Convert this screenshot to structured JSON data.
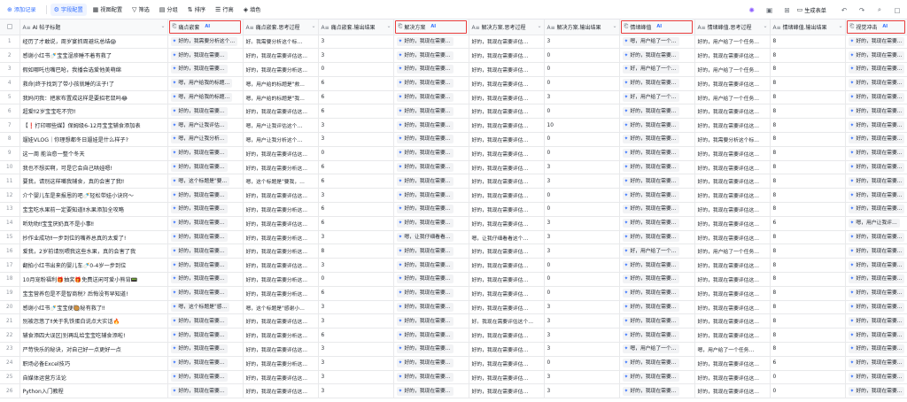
{
  "toolbar": {
    "add_record": "添加记录",
    "field_config": "字段配置",
    "view_config": "视图配置",
    "filter": "筛选",
    "group": "分组",
    "sort": "排序",
    "row_height": "行高",
    "fill_color": "填色",
    "generate_form": "生成表单",
    "accent_color": "#3370ff",
    "highlight_color": "#e83b3b"
  },
  "columns": [
    {
      "label": "AI 帖子标题",
      "icon": "text-icon",
      "ai": false
    },
    {
      "label": "痛点嵌套",
      "icon": "ai-field-icon",
      "ai": true,
      "highlight": true
    },
    {
      "label": "痛点嵌套.思考过程",
      "icon": "text-icon",
      "ai": false
    },
    {
      "label": "痛点嵌套.输出结果",
      "icon": "text-icon",
      "ai": false
    },
    {
      "label": "解决方案",
      "icon": "ai-field-icon",
      "ai": true,
      "highlight": true
    },
    {
      "label": "解决方案.思考过程",
      "icon": "text-icon",
      "ai": false
    },
    {
      "label": "解决方案.输出结果",
      "icon": "text-icon",
      "ai": false
    },
    {
      "label": "情绪峰值",
      "icon": "ai-field-icon",
      "ai": true,
      "highlight": true
    },
    {
      "label": "情绪峰值.思考过程",
      "icon": "text-icon",
      "ai": false
    },
    {
      "label": "情绪峰值.输出结果",
      "icon": "text-icon",
      "ai": false
    },
    {
      "label": "视觉冲击",
      "icon": "ai-field-icon",
      "ai": true,
      "highlight": true
    }
  ],
  "rows": [
    {
      "n": "1",
      "title": "经历了才敢说，周岁宴抓周避坑总结😱",
      "c1": "好的，我需要分析这个…",
      "c2": "好。我需要分析这个标…",
      "c3": "3",
      "c4": "好的，我现在需要…",
      "c5": "好的，我现在需要评估…",
      "c6": "3",
      "c7": "嗯，用户给了一个…",
      "c8": "好的，用户给了一个任务…",
      "c9": "8",
      "c10": "好的，我现在需要…"
    },
    {
      "n": "2",
      "title": "感谢小红书🍼宝宝湿疹睡不着有救了",
      "c1": "好的，我现在需要…",
      "c2": "好的，我现在需要评估这…",
      "c3": "3",
      "c4": "好的，我现在需要…",
      "c5": "好的，我现在需要评估…",
      "c6": "0",
      "c7": "好的，我现在需要…",
      "c8": "好的，我现在需要评估这…",
      "c9": "8",
      "c10": "好的，我现在需要…"
    },
    {
      "n": "3",
      "title": "假如哪吒也嘴巴呛，我播会选爱他美萌绵",
      "c1": "好的，我现在需要…",
      "c2": "好的，我现在需要分析这…",
      "c3": "0",
      "c4": "好的，我现在需要…",
      "c5": "好的，我现在需要评估…",
      "c6": "0",
      "c7": "好，用户给了一个…",
      "c8": "好的，用户给了一个任务…",
      "c9": "8",
      "c10": "好的，我现在需要…"
    },
    {
      "n": "4",
      "title": "救命|终于找到了带小孩就睡的法子!了",
      "c1": "嗯，用户给我的标题…",
      "c2": "嗯，用户给的标题是\"救…",
      "c3": "6",
      "c4": "好的，我现在需要…",
      "c5": "好的，我现在需要评估…",
      "c6": "0",
      "c7": "好的，我现在需要…",
      "c8": "好的，我现在需要评估这…",
      "c9": "8",
      "c10": "好的，我现在需要…"
    },
    {
      "n": "5",
      "title": "我妈问我：把家布置成这样是要招老鼠吗😂",
      "c1": "嗯，用户给我的标题…",
      "c2": "嗯，用户给的标题是\"我…",
      "c3": "6",
      "c4": "好的，我现在需要…",
      "c5": "好的，我现在需要评估…",
      "c6": "3",
      "c7": "好，用户给了一个…",
      "c8": "好的，用户给了一个任务…",
      "c9": "8",
      "c10": "好的，我现在需要…"
    },
    {
      "n": "6",
      "title": "超爱‼2岁宝宝吃不完‼",
      "c1": "好的，我现在需要…",
      "c2": "好的，我现在需要评估这…",
      "c3": "6",
      "c4": "好的，我现在需要…",
      "c5": "好的，我现在需要评估…",
      "c6": "0",
      "c7": "好的，我现在需要…",
      "c8": "好的，我现在需要评估这…",
      "c9": "8",
      "c10": "好的，我现在需要…"
    },
    {
      "n": "7",
      "title": "【❗打印哪些媒】保姆级6-12月宝宝辅食添加表",
      "c1": "嗯，用户让我评估…",
      "c2": "嗯，用户让我评估这个…",
      "c3": "3",
      "c4": "好的，我现在需要…",
      "c5": "好的，我现在需要评估…",
      "c6": "10",
      "c7": "好的，我现在需要…",
      "c8": "好的，我现在需要评估这…",
      "c9": "8",
      "c10": "好的，我现在需要…"
    },
    {
      "n": "8",
      "title": "遛娃VLOG｜你理想都冬日遛娃是什么样子?",
      "c1": "嗯，用户让我分析…",
      "c2": "嗯，用户让我分析这个…",
      "c3": "3",
      "c4": "好的，我现在需要…",
      "c5": "好的，我现在需要评估…",
      "c6": "0",
      "c7": "好的，我现在需要…",
      "c8": "好的，我需要分析这个标…",
      "c9": "8",
      "c10": "好的，我现在需要…"
    },
    {
      "n": "9",
      "title": "这一周 能治愈一整个冬天",
      "c1": "好的，我现在需要…",
      "c2": "好的，我现在需要评估这…",
      "c3": "0",
      "c4": "好的，我现在需要…",
      "c5": "好的，我现在需要评估…",
      "c6": "0",
      "c7": "好的，我现在需要…",
      "c8": "好的，我现在需要评估这…",
      "c9": "8",
      "c10": "好的，我现在需要…"
    },
    {
      "n": "10",
      "title": "我也不想买啊，可是它会自己哄娃嗯!",
      "c1": "好的，我现在需要…",
      "c2": "好的，我现在需要分析这…",
      "c3": "6",
      "c4": "好的，我现在需要…",
      "c5": "好的，我现在需要评估…",
      "c6": "3",
      "c7": "好的，我现在需要…",
      "c8": "好的，我现在需要评估这…",
      "c9": "8",
      "c10": "好的，我现在需要…"
    },
    {
      "n": "11",
      "title": "要我，请别这样嘴我辅食，真的会害了我‼",
      "c1": "嗯，这个标题是\"要…",
      "c2": "嗯，这个标题是\"要我，…",
      "c3": "6",
      "c4": "好的，我现在需要…",
      "c5": "好的，我现在需要评估…",
      "c6": "3",
      "c7": "好的，我现在需要…",
      "c8": "好的，我现在需要评估这…",
      "c9": "8",
      "c10": "好的，我现在需要…"
    },
    {
      "n": "12",
      "title": "介个婴儿车是来报恩的吧🍼轻松带娃小诀窍～",
      "c1": "好的，我现在需要…",
      "c2": "好的，我现在需要评估这…",
      "c3": "3",
      "c4": "好的，我现在需要…",
      "c5": "好的，我现在需要评估…",
      "c6": "0",
      "c7": "好的，我现在需要…",
      "c8": "好的，我现在需要评估这…",
      "c9": "8",
      "c10": "好的，我现在需要…"
    },
    {
      "n": "13",
      "title": "宝宝吃水果前一定要知道‼水果添加全攻略",
      "c1": "好的，我现在需要…",
      "c2": "好的，我现在需要分析这…",
      "c3": "6",
      "c4": "好的，我现在需要…",
      "c5": "好的，我现在需要评估…",
      "c6": "0",
      "c7": "好的，我现在需要…",
      "c8": "好的，我现在需要评估这…",
      "c9": "8",
      "c10": "好的，我现在需要…"
    },
    {
      "n": "14",
      "title": "听劝劝‼宝宝厌奶真不是小事‼",
      "c1": "好的，我现在需要…",
      "c2": "好的，我现在需要评估这…",
      "c3": "6",
      "c4": "好的，我现在需要…",
      "c5": "好的，我现在需要评估…",
      "c6": "3",
      "c7": "好的，我现在需要…",
      "c8": "好的，我现在需要评估这…",
      "c9": "6",
      "c10": "嗯，用户让我评…"
    },
    {
      "n": "15",
      "title": "抄作业成功‼一步到位的嘴养总真的太爱了!",
      "c1": "好的，我现在需要…",
      "c2": "好的，我现在需要分析这…",
      "c3": "3",
      "c4": "嗯，让我仔细看看…",
      "c5": "嗯，让我仔细看看这个…",
      "c6": "3",
      "c7": "好的，我现在需要…",
      "c8": "好的，我现在需要评估这…",
      "c9": "8",
      "c10": "好的，我现在需要…"
    },
    {
      "n": "16",
      "title": "爱我，2岁前请别喂我这些水果，真的会害了我",
      "c1": "好的，我现在需要…",
      "c2": "好的，我现在需要分析这…",
      "c3": "8",
      "c4": "好的，我现在需要…",
      "c5": "好的，我现在需要评估…",
      "c6": "3",
      "c7": "好，用户给了一个…",
      "c8": "好的，用户给了一个任务…",
      "c9": "8",
      "c10": "好的，我现在需要…"
    },
    {
      "n": "17",
      "title": "翻拍小红书出来的婴儿车🍼0-4岁一步到位",
      "c1": "好的，我现在需要…",
      "c2": "好的，我现在需要评估这…",
      "c3": "3",
      "c4": "好的，我现在需要…",
      "c5": "好的，我现在需要评估…",
      "c6": "0",
      "c7": "好的，我现在需要…",
      "c8": "好的，我现在需要评估这…",
      "c9": "8",
      "c10": "好的，我现在需要…"
    },
    {
      "n": "18",
      "title": "10月宠粉福利🎁抽奖🎁免费送闲可爱小熊背📟",
      "c1": "好的，我现在需要…",
      "c2": "好的，我现在需要分析这…",
      "c3": "0",
      "c4": "好的，我现在需要…",
      "c5": "好的，我现在需要评估…",
      "c6": "0",
      "c7": "好的，我现在需要…",
      "c8": "好的，我现在需要评估这…",
      "c9": "8",
      "c10": "好的，我现在需要…"
    },
    {
      "n": "19",
      "title": "宝宝营养包是不是智商税? 后悔没有早知道!",
      "c1": "好的，我现在需要…",
      "c2": "好的，我现在需要分析这…",
      "c3": "6",
      "c4": "好的，我现在需要…",
      "c5": "好的，我现在需要评估…",
      "c6": "0",
      "c7": "好的，我现在需要…",
      "c8": "好的，我现在需要评估这…",
      "c9": "8",
      "c10": "好的，我现在需要…"
    },
    {
      "n": "20",
      "title": "感谢小红书🍼宝宝便🥘秘有救了‼",
      "c1": "嗯，这个标题是\"感…",
      "c2": "嗯，这个标题是\"感谢小…",
      "c3": "3",
      "c4": "好的，我现在需要…",
      "c5": "好的，我现在需要评估…",
      "c6": "3",
      "c7": "好的，我现在需要…",
      "c8": "好的，我现在需要评估这…",
      "c9": "8",
      "c10": "好的，我现在需要…"
    },
    {
      "n": "21",
      "title": "别被忽悠了‼关于乳铁蛋白说点大实话🔥",
      "c1": "好的，我现在需要…",
      "c2": "好的，我现在需要评估这…",
      "c3": "3",
      "c4": "好的，我现在需要…",
      "c5": "好。我现在需要评估这个…",
      "c6": "3",
      "c7": "好的，我现在需要…",
      "c8": "好的，我现在需要评估这…",
      "c9": "8",
      "c10": "好的，我现在需要…"
    },
    {
      "n": "22",
      "title": "辅食添四大误区|别再乱给宝宝吃辅食添啦!",
      "c1": "好的，我现在需要…",
      "c2": "好的，我现在需要分析这…",
      "c3": "6",
      "c4": "好的，我现在需要…",
      "c5": "好的，我现在需要评估…",
      "c6": "3",
      "c7": "好的，我现在需要…",
      "c8": "好的，我现在需要评估这…",
      "c9": "8",
      "c10": "好的，我现在需要…"
    },
    {
      "n": "23",
      "title": "严苛快乐的秘诀，对自己好一点更好一点",
      "c1": "好的，我现在需要…",
      "c2": "好的，我现在需要评估这…",
      "c3": "3",
      "c4": "好的，我现在需要…",
      "c5": "好的，我现在需要评估…",
      "c6": "3",
      "c7": "嗯，用户给了一个…",
      "c8": "嗯，用户给了一个任务…",
      "c9": "8",
      "c10": "好的，我现在需要…"
    },
    {
      "n": "24",
      "title": "职场必备Excel技巧",
      "c1": "好的，我现在需要…",
      "c2": "好的，我现在需要分析这…",
      "c3": "3",
      "c4": "好的，我现在需要…",
      "c5": "好的，我现在需要评估…",
      "c6": "0",
      "c7": "好的，我现在需要…",
      "c8": "好的，我现在需要评估这…",
      "c9": "6",
      "c10": "好的，我现在需要…"
    },
    {
      "n": "25",
      "title": "自媒体运营方法论",
      "c1": "好的，我现在需要…",
      "c2": "好的，我现在需要评估这…",
      "c3": "3",
      "c4": "好的，我现在需要…",
      "c5": "好的，我现在需要评估…",
      "c6": "3",
      "c7": "好的，我现在需要…",
      "c8": "好的，我现在需要评估这…",
      "c9": "0",
      "c10": "好的，我现在需要…"
    },
    {
      "n": "26",
      "title": "Python入门教程",
      "c1": "好的，我现在需要…",
      "c2": "好的，我现在需要评估这…",
      "c3": "3",
      "c4": "好的，我现在需要…",
      "c5": "好的，我现在需要评估…",
      "c6": "3",
      "c7": "好的，我现在需要…",
      "c8": "好的，我现在需要评估这…",
      "c9": "0",
      "c10": "好的，我现在需要…"
    }
  ]
}
